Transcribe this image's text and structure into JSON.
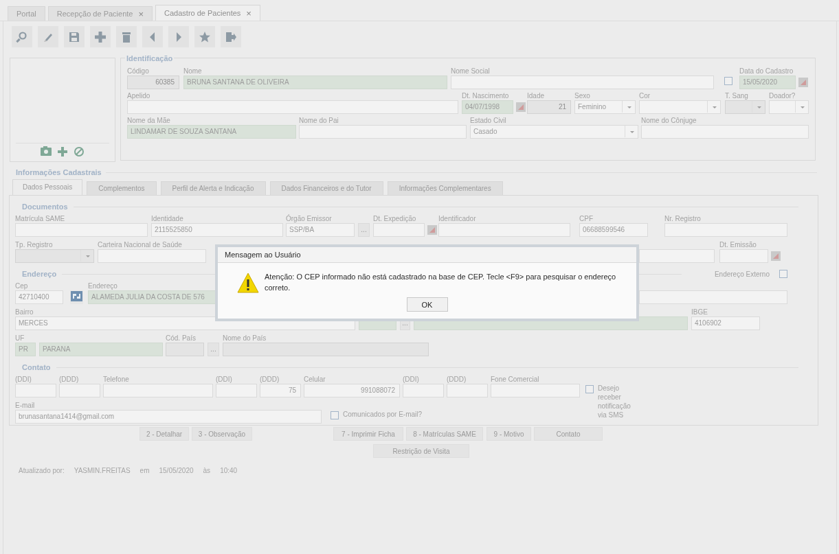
{
  "tabs": [
    {
      "label": "Portal",
      "selected": false,
      "closable": false
    },
    {
      "label": "Recepção de Paciente",
      "selected": false,
      "closable": true
    },
    {
      "label": "Cadastro de Pacientes",
      "selected": true,
      "closable": true
    }
  ],
  "close_glyph": "×",
  "identification": {
    "title": "Identificação",
    "lines": [
      [
        {
          "kind": "number",
          "label": "Código",
          "value": "60385",
          "disabled": true,
          "highlighted": false
        },
        {
          "kind": "text",
          "label": "Nome",
          "value": "BRUNA SANTANA DE OLIVEIRA",
          "disabled": false,
          "highlighted": true
        },
        {
          "kind": "text",
          "label": "Nome Social",
          "disabled": false,
          "highlighted": false
        },
        {
          "kind": "check",
          "checked": false
        },
        {
          "kind": "date",
          "label": "Data do Cadastro",
          "value": "15/05/2020",
          "disabled": false,
          "highlighted": true
        }
      ],
      [
        {
          "kind": "text",
          "label": "Apelido",
          "disabled": false,
          "highlighted": false
        },
        {
          "kind": "date",
          "label": "Dt. Nascimento",
          "value": "04/07/1998",
          "disabled": false,
          "highlighted": true
        },
        {
          "kind": "number",
          "label": "Idade",
          "value": "21",
          "disabled": true,
          "highlighted": false
        },
        {
          "kind": "select",
          "label": "Sexo",
          "value": "Feminino",
          "disabled": false,
          "highlighted": false
        },
        {
          "kind": "select",
          "label": "Cor",
          "disabled": false,
          "highlighted": false
        },
        {
          "kind": "select",
          "label": "T. Sang",
          "disabled": true,
          "highlighted": false
        },
        {
          "kind": "select",
          "label": "Doador?",
          "disabled": false,
          "highlighted": false
        }
      ],
      [
        {
          "kind": "text",
          "label": "Nome da Mãe",
          "value": "LINDAMAR DE SOUZA SANTANA",
          "disabled": false,
          "highlighted": true
        },
        {
          "kind": "text",
          "label": "Nome do Pai",
          "disabled": false,
          "highlighted": false
        },
        {
          "kind": "select",
          "label": "Estado Civil",
          "value": "Casado",
          "disabled": false,
          "highlighted": false
        },
        {
          "kind": "text",
          "label": "Nome do Cônjuge",
          "disabled": false,
          "highlighted": false
        }
      ]
    ]
  },
  "section_title": "Informações Cadastrais",
  "inner_tabs": [
    {
      "label": "Dados Pessoais",
      "selected": true
    },
    {
      "label": "Complementos",
      "selected": false
    },
    {
      "label": "Perfil de Alerta e Indicação",
      "selected": false
    },
    {
      "label": "Dados Financeiros e do Tutor",
      "selected": false
    },
    {
      "label": "Informações Complementares",
      "selected": false
    }
  ],
  "groups": [
    {
      "title": "Documentos",
      "lines": [
        [
          {
            "kind": "text",
            "label": "Matrícula SAME",
            "disabled": false,
            "highlighted": false
          },
          {
            "kind": "text",
            "label": "Identidade",
            "value": "2115525850",
            "disabled": false,
            "highlighted": false
          },
          {
            "kind": "text",
            "label": "Órgão Emissor",
            "value": "SSP/BA",
            "disabled": false,
            "highlighted": false
          },
          {
            "kind": "lookup",
            "value": "..."
          },
          {
            "kind": "date",
            "label": "Dt. Expedição",
            "disabled": false,
            "highlighted": false
          },
          {
            "kind": "text",
            "label": "Identificador",
            "disabled": false,
            "highlighted": false
          },
          {
            "kind": "text",
            "label": "CPF",
            "value": "06688599546",
            "disabled": false,
            "highlighted": false
          },
          {
            "kind": "text",
            "label": "Nr. Registro",
            "disabled": false,
            "highlighted": false
          }
        ],
        [
          {
            "kind": "select",
            "label": "Tp. Registro",
            "disabled": true,
            "highlighted": false
          },
          {
            "kind": "text",
            "label": "Carteira Nacional de Saúde",
            "disabled": false,
            "highlighted": false
          },
          {
            "kind": "text",
            "disabled": false,
            "highlighted": false
          },
          {
            "kind": "date",
            "label": "Dt. Emissão",
            "disabled": false,
            "highlighted": false
          }
        ]
      ]
    },
    {
      "title": "Endereço",
      "option": {
        "label": "Endereço Externo",
        "checked": false
      },
      "lines": [
        [
          {
            "kind": "text",
            "label": "Cep",
            "value": "42710400",
            "disabled": false,
            "highlighted": false
          },
          {
            "kind": "cep"
          },
          {
            "kind": "text",
            "label": "Endereço",
            "value": "ALAMEDA JULIA DA COSTA DE 576",
            "disabled": false,
            "highlighted": true
          },
          {
            "kind": "text",
            "disabled": false,
            "highlighted": false
          }
        ],
        [
          {
            "kind": "text",
            "label": "Bairro",
            "value": "MERCES",
            "disabled": false,
            "highlighted": false
          },
          {
            "kind": "text",
            "disabled": false,
            "highlighted": true
          },
          {
            "kind": "lookup",
            "value": "..."
          },
          {
            "kind": "text",
            "disabled": false,
            "highlighted": true
          },
          {
            "kind": "text",
            "label": "IBGE",
            "value": "4106902",
            "disabled": false,
            "highlighted": false
          }
        ],
        [
          {
            "kind": "text",
            "label": "UF",
            "value": "PR",
            "disabled": false,
            "highlighted": true
          },
          {
            "kind": "text",
            "value": "PARANA",
            "disabled": false,
            "highlighted": true
          },
          {
            "kind": "text",
            "label": "Cód. País",
            "disabled": true,
            "highlighted": false
          },
          {
            "kind": "lookup",
            "value": "..."
          },
          {
            "kind": "text",
            "label": "Nome do País",
            "disabled": true,
            "highlighted": false
          }
        ]
      ]
    },
    {
      "title": "Contato",
      "lines": [
        [
          {
            "kind": "text",
            "label": "(DDI)",
            "disabled": false,
            "highlighted": false
          },
          {
            "kind": "text",
            "label": "(DDD)",
            "disabled": false,
            "highlighted": false
          },
          {
            "kind": "text",
            "label": "Telefone",
            "disabled": false,
            "highlighted": false
          },
          {
            "kind": "text",
            "label": "(DDI)",
            "disabled": false,
            "highlighted": false
          },
          {
            "kind": "number",
            "label": "(DDD)",
            "value": "75",
            "disabled": false,
            "highlighted": false
          },
          {
            "kind": "number",
            "label": "Celular",
            "value": "991088072",
            "disabled": false,
            "highlighted": false
          },
          {
            "kind": "text",
            "label": "(DDI)",
            "disabled": false,
            "highlighted": false
          },
          {
            "kind": "text",
            "label": "(DDD)",
            "disabled": false,
            "highlighted": false
          },
          {
            "kind": "text",
            "label": "Fone Comercial",
            "disabled": false,
            "highlighted": false
          },
          {
            "kind": "check",
            "text": "Desejo receber notificação via SMS",
            "checked": false
          }
        ],
        [
          {
            "kind": "text",
            "label": "E-mail",
            "value": "brunasantana1414@gmail.com",
            "disabled": false,
            "highlighted": false
          },
          {
            "kind": "check",
            "text": "Comunicados por E-mail?",
            "checked": false
          }
        ]
      ]
    }
  ],
  "buttons": [
    [
      "2 - Detalhar",
      "3 - Observação",
      "7 - Imprimir Ficha",
      "8 - Matrículas SAME",
      "9 - Motivo",
      "Contato"
    ],
    [
      "Restrição de Visita"
    ]
  ],
  "footer": [
    "Atualizado por:",
    "YASMIN.FREITAS",
    "em",
    "15/05/2020",
    "às",
    "10:40"
  ],
  "dialog": {
    "title": "Mensagem ao Usuário",
    "message": "Atenção: O CEP informado não está cadastrado na base de CEP. Tecle <F9> para pesquisar o endereço correto.",
    "button": "OK"
  }
}
